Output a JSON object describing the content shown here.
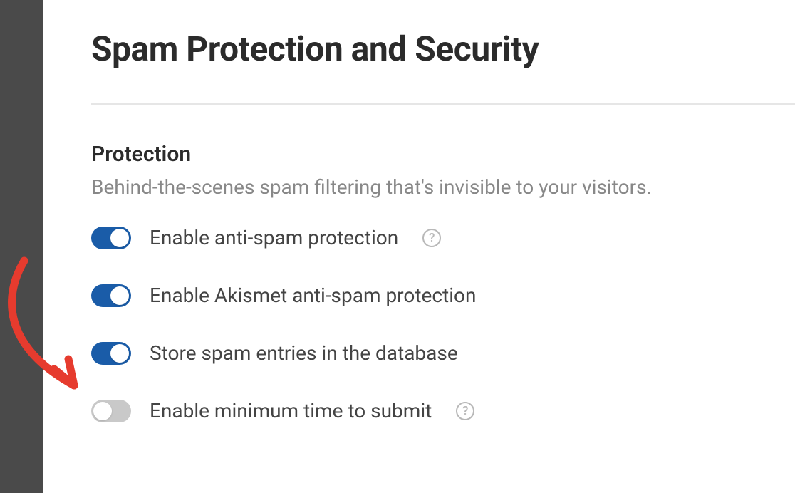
{
  "page": {
    "title": "Spam Protection and Security"
  },
  "section": {
    "title": "Protection",
    "description": "Behind-the-scenes spam filtering that's invisible to your visitors."
  },
  "settings": [
    {
      "label": "Enable anti-spam protection",
      "enabled": true,
      "has_help": true
    },
    {
      "label": "Enable Akismet anti-spam protection",
      "enabled": true,
      "has_help": false
    },
    {
      "label": "Store spam entries in the database",
      "enabled": true,
      "has_help": false
    },
    {
      "label": "Enable minimum time to submit",
      "enabled": false,
      "has_help": true
    }
  ],
  "help_glyph": "?"
}
